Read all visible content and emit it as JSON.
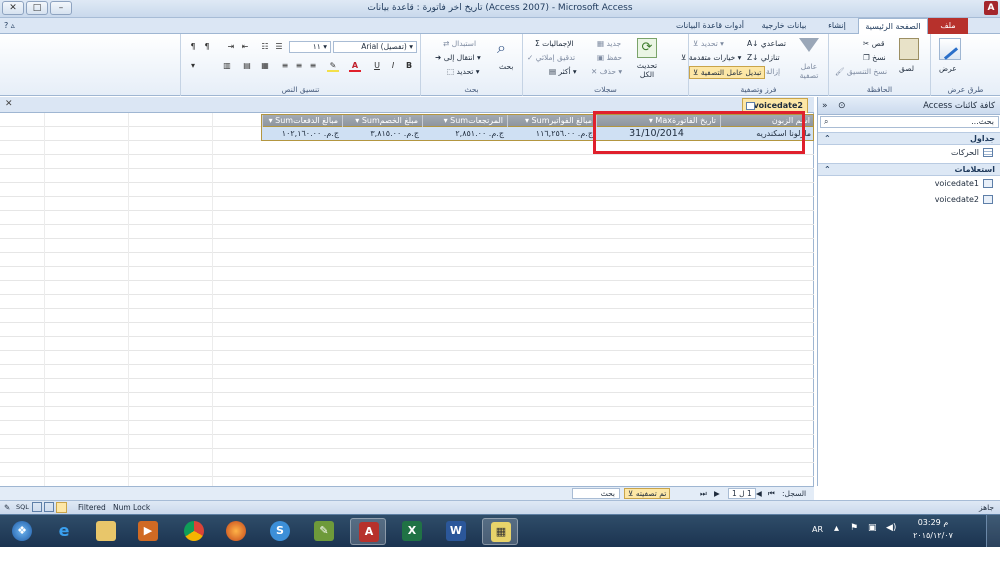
{
  "window": {
    "title": "تاريخ  اخر فاتورة : قاعدة بيانات (Access 2007) - Microsoft Access",
    "buttons": {
      "minimize": "–",
      "maximize": "□",
      "close": "✕"
    }
  },
  "ribbon_tabs": [
    {
      "label": "ملف"
    },
    {
      "label": "الصفحة الرئيسية"
    },
    {
      "label": "إنشاء"
    },
    {
      "label": "بيانات خارجية"
    },
    {
      "label": "أدوات قاعدة البيانات"
    }
  ],
  "ribbon": {
    "views": {
      "view_label": "عرض",
      "group_label": "طرق عرض"
    },
    "clipboard": {
      "paste_label": "لصق",
      "cut_label": "قص",
      "copy_label": "نسخ",
      "format_painter_label": "نسخ التنسيق",
      "group_label": "الحافظة"
    },
    "sort_filter": {
      "filter_label": "عامل تصفية",
      "ascending_label": "تصاعدي",
      "descending_label": "تنازلي",
      "remove_sort_label": "إزالة الفرز",
      "selection_label": "تحديد",
      "advanced_label": "خيارات متقدمة",
      "toggle_filter_label": "تبديل عامل التصفية",
      "group_label": "فرز وتصفية"
    },
    "records": {
      "refresh_label": "تحديث الكل",
      "new_label": "جديد",
      "save_label": "حفظ",
      "delete_label": "حذف",
      "totals_label": "الإجماليات",
      "spelling_label": "تدقيق إملائي",
      "more_label": "أكثر",
      "group_label": "سجلات"
    },
    "find": {
      "find_label": "بحث",
      "replace_label": "استبدال",
      "goto_label": "انتقال إلى",
      "select_label": "تحديد",
      "group_label": "بحث"
    },
    "text_formatting": {
      "font_name": "(تفصيل) Arial",
      "font_size": "١١",
      "bold": "B",
      "italic": "I",
      "underline": "U",
      "font_color_glyph": "A",
      "group_label": "تنسيق النص"
    }
  },
  "document_tab": {
    "label": "voicedate2"
  },
  "datasheet": {
    "columns": [
      {
        "label": "اسم الزبون"
      },
      {
        "label": "Maxتاريخ الفاتورة"
      },
      {
        "label": "Sumمبالغ الفواتير"
      },
      {
        "label": "Sumالمرتجعات"
      },
      {
        "label": "Sumمبلغ الخصم"
      },
      {
        "label": "Sumمبالغ الدفعات"
      }
    ],
    "rows": [
      {
        "customer": "مارلونا اسكندريه",
        "date": "31/10/2014",
        "invoices": "ج.م. ١١٦,٢٥٦.٠٠",
        "returns": "ج.م. ٢,٨٥١.٠٠",
        "discount": "ج.م. ٣,٨١٥.٠٠",
        "payments": "ج.م. ١٠٢,١٦٠.٠٠"
      }
    ]
  },
  "nav_pane": {
    "title": "كافة كائنات Access",
    "search_placeholder": "بحث...",
    "groups": [
      {
        "label": "جداول",
        "items": [
          {
            "label": "الحركات"
          }
        ]
      },
      {
        "label": "استعلامات",
        "items": [
          {
            "label": "voicedate1"
          },
          {
            "label": "voicedate2"
          }
        ]
      }
    ]
  },
  "record_nav": {
    "record_label": "السجل:",
    "position": "1 ل 1",
    "filter_label": "تم تصفيته",
    "search_label": "بحث",
    "first": "⏮",
    "prev": "◀",
    "next": "▶",
    "last": "⏭"
  },
  "status_bar": {
    "ready": "جاهز",
    "filtered": "Filtered",
    "numlock": "Num Lock",
    "sql": "SQL"
  },
  "taskbar": {
    "apps": [
      "start",
      "ie",
      "explorer",
      "media",
      "chrome",
      "firefox",
      "app-s",
      "app-p",
      "access",
      "excel",
      "word",
      "movie"
    ],
    "lang": "AR",
    "time": "03:29 م",
    "date": "٢٠١٥/١٢/٠٧"
  }
}
